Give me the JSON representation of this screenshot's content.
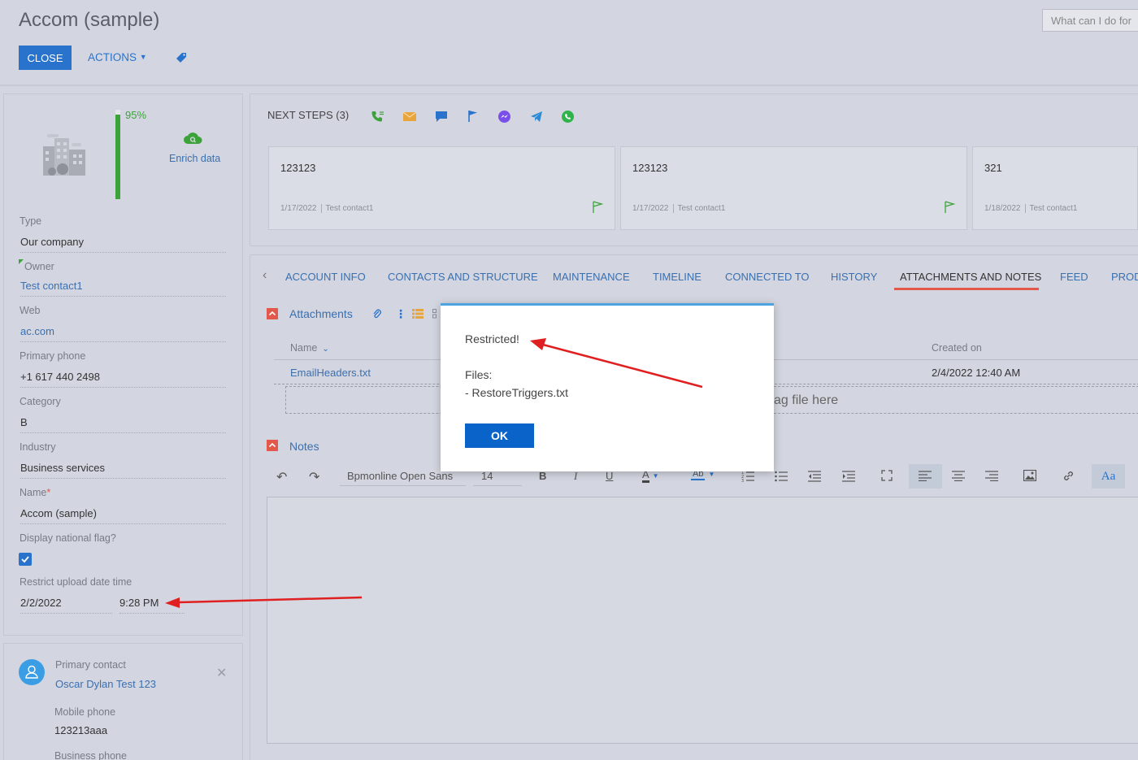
{
  "header": {
    "title": "Accom (sample)",
    "close_label": "CLOSE",
    "actions_label": "ACTIONS",
    "search_placeholder": "What can I do for"
  },
  "profile": {
    "completeness": "95%",
    "completeness_value": 0.95,
    "enrich_label": "Enrich data"
  },
  "fields": [
    {
      "label": "Type",
      "value": "Our company",
      "link": false
    },
    {
      "label": "Owner",
      "value": "Test contact1",
      "link": true
    },
    {
      "label": "Web",
      "value": "ac.com",
      "link": true
    },
    {
      "label": "Primary phone",
      "value": "+1 617 440 2498",
      "link": false
    },
    {
      "label": "Category",
      "value": "B",
      "link": false
    },
    {
      "label": "Industry",
      "value": "Business services",
      "link": false
    },
    {
      "label": "Name",
      "value": "Accom (sample)",
      "link": false
    }
  ],
  "flag_field": {
    "label": "Display national flag?",
    "checked": true
  },
  "restrict": {
    "label": "Restrict upload date time",
    "date": "2/2/2022",
    "time": "9:28 PM"
  },
  "contact": {
    "role": "Primary contact",
    "name": "Oscar Dylan Test 123",
    "mobile_label": "Mobile phone",
    "mobile_value": "123213aaa",
    "business_label": "Business phone"
  },
  "next_steps": {
    "title": "NEXT STEPS (3)",
    "cards": [
      {
        "title": "123123",
        "date": "1/17/2022",
        "owner": "Test contact1"
      },
      {
        "title": "123123",
        "date": "1/17/2022",
        "owner": "Test contact1"
      },
      {
        "title": "321",
        "date": "1/18/2022",
        "owner": "Test contact1"
      }
    ]
  },
  "tabs": [
    "ACCOUNT INFO",
    "CONTACTS AND STRUCTURE",
    "MAINTENANCE",
    "TIMELINE",
    "CONNECTED TO",
    "HISTORY",
    "ATTACHMENTS AND NOTES",
    "FEED",
    "PROD"
  ],
  "attachments": {
    "title": "Attachments",
    "col_name": "Name",
    "col_created": "Created on",
    "rows": [
      {
        "name": "EmailHeaders.txt",
        "created": "2/4/2022 12:40 AM"
      }
    ],
    "drop_text": "ag file here"
  },
  "notes": {
    "title": "Notes",
    "font_name": "Bpmonline Open Sans",
    "font_size": "14"
  },
  "modal": {
    "line1": "Restricted!",
    "line2": "Files:",
    "line3": "- RestoreTriggers.txt",
    "ok_label": "OK"
  },
  "colors": {
    "accent": "#2a73cc",
    "completeness": "#3ca33a",
    "section": "#e2584b",
    "arrow": "#e02020"
  }
}
